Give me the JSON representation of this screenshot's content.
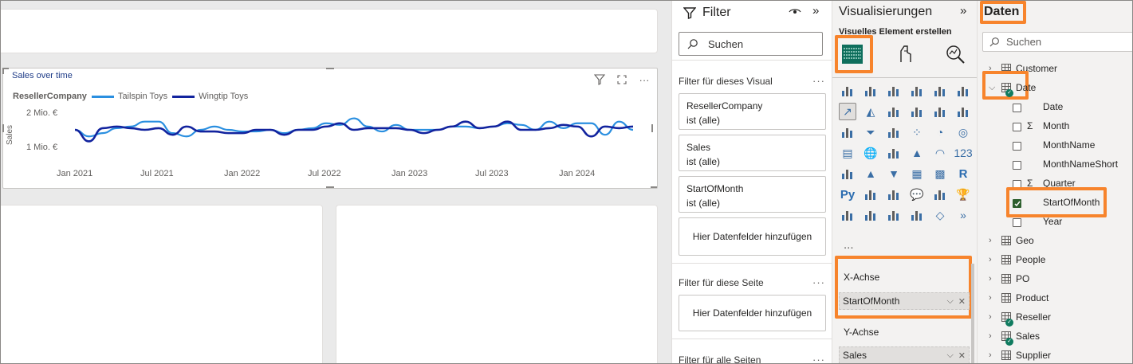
{
  "visual": {
    "title": "Sales over time",
    "legend_title": "ResellerCompany",
    "series_colors": [
      "#2a8fe0",
      "#12239e"
    ]
  },
  "chart_data": {
    "type": "line",
    "title": "Sales over time",
    "xlabel": "",
    "ylabel": "Sales",
    "x_ticks": [
      "Jan 2021",
      "Jul 2021",
      "Jan 2022",
      "Jul 2022",
      "Jan 2023",
      "Jul 2023",
      "Jan 2024"
    ],
    "y_ticks": [
      "2 Mio. €",
      "1 Mio. €"
    ],
    "ylim": [
      0.5,
      2.1
    ],
    "x": [
      "2021-01",
      "2021-02",
      "2021-03",
      "2021-04",
      "2021-05",
      "2021-06",
      "2021-07",
      "2021-08",
      "2021-09",
      "2021-10",
      "2021-11",
      "2021-12",
      "2022-01",
      "2022-02",
      "2022-03",
      "2022-04",
      "2022-05",
      "2022-06",
      "2022-07",
      "2022-08",
      "2022-09",
      "2022-10",
      "2022-11",
      "2022-12",
      "2023-01",
      "2023-02",
      "2023-03",
      "2023-04",
      "2023-05",
      "2023-06",
      "2023-07",
      "2023-08",
      "2023-09",
      "2023-10",
      "2023-11",
      "2023-12",
      "2024-01",
      "2024-02",
      "2024-03",
      "2024-04",
      "2024-05"
    ],
    "series": [
      {
        "name": "Tailspin Toys",
        "values": [
          1.3,
          1.1,
          1.2,
          1.35,
          1.4,
          1.55,
          1.55,
          1.2,
          1.1,
          1.3,
          1.4,
          1.3,
          1.25,
          1.25,
          1.3,
          1.2,
          1.3,
          1.35,
          1.5,
          1.45,
          1.65,
          1.4,
          1.25,
          1.45,
          1.3,
          1.3,
          1.3,
          1.4,
          1.4,
          1.35,
          1.4,
          1.5,
          1.45,
          1.3,
          1.55,
          1.35,
          1.5,
          1.5,
          1.15,
          1.55,
          1.3
        ]
      },
      {
        "name": "Wingtip Toys",
        "values": [
          1.3,
          0.95,
          1.35,
          1.4,
          1.35,
          1.3,
          1.35,
          1.15,
          1.4,
          1.25,
          1.25,
          1.2,
          1.2,
          1.3,
          1.3,
          1.15,
          1.3,
          1.3,
          1.4,
          1.5,
          1.3,
          1.35,
          1.35,
          1.35,
          1.3,
          1.2,
          1.3,
          1.4,
          1.55,
          1.35,
          1.4,
          1.55,
          1.3,
          1.3,
          1.35,
          1.45,
          1.4,
          1.1,
          1.4,
          1.35,
          1.4
        ]
      }
    ],
    "grid": false,
    "legend": "top-left"
  },
  "filter": {
    "title": "Filter",
    "search_placeholder": "Suchen",
    "visual_section": "Filter für dieses Visual",
    "cards": [
      {
        "field": "ResellerCompany",
        "state": "ist (alle)"
      },
      {
        "field": "Sales",
        "state": "ist (alle)"
      },
      {
        "field": "StartOfMonth",
        "state": "ist (alle)"
      }
    ],
    "add_fields": "Hier Datenfelder hinzufügen",
    "page_section": "Filter für diese Seite",
    "page_add_fields": "Hier Datenfelder hinzufügen",
    "all_pages_section": "Filter für alle Seiten"
  },
  "viz": {
    "title": "Visualisierungen",
    "subtitle": "Visuelles Element erstellen",
    "more": "...",
    "x_axis_label": "X-Achse",
    "x_axis_field": "StartOfMonth",
    "y_axis_label": "Y-Achse",
    "y_axis_field": "Sales"
  },
  "data": {
    "title": "Daten",
    "search_placeholder": "Suchen",
    "tables_before": [
      "Customer"
    ],
    "date_table": "Date",
    "date_fields": [
      "Date",
      "Month",
      "MonthName",
      "MonthNameShort",
      "Quarter",
      "StartOfMonth",
      "Year"
    ],
    "tables_after": [
      "Geo",
      "People",
      "PO",
      "Product",
      "Reseller",
      "Sales",
      "Supplier"
    ],
    "highlight_color": "#f7842c"
  }
}
